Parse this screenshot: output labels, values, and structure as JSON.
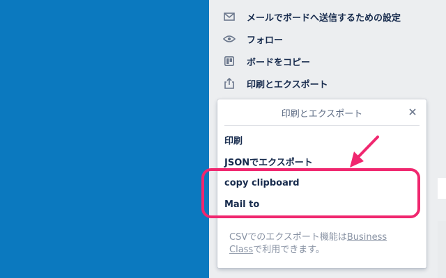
{
  "sidebar": {
    "items": [
      {
        "label": "メールでボードへ送信するための設定",
        "icon": "mail-icon"
      },
      {
        "label": "フォロー",
        "icon": "eye-icon"
      },
      {
        "label": "ボードをコピー",
        "icon": "board-icon"
      },
      {
        "label": "印刷とエクスポート",
        "icon": "share-icon"
      }
    ]
  },
  "popover": {
    "title": "印刷とエクスポート",
    "close_icon": "close-icon",
    "items": [
      {
        "label": "印刷"
      },
      {
        "label": "JSONでエクスポート"
      },
      {
        "label": "copy clipboard"
      },
      {
        "label": "Mail to"
      }
    ],
    "note_prefix": "CSVでのエクスポート機能は",
    "note_link": "Business Class",
    "note_suffix": "で利用できます。"
  },
  "colors": {
    "board_background": "#0b79bf",
    "sidebar_background": "#eceef0",
    "highlight": "#f0276f"
  }
}
